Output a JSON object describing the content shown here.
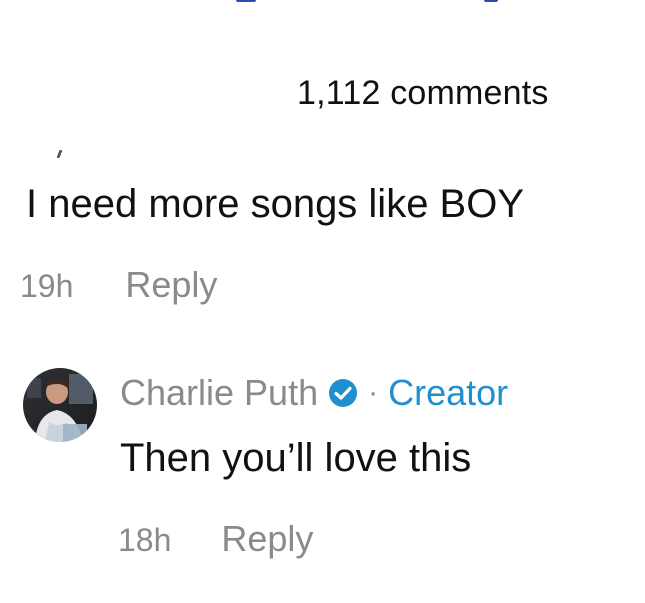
{
  "header": {
    "comment_count": "1,112 comments"
  },
  "comment": {
    "text": "I need more songs like BOY",
    "time": "19h",
    "reply_label": "Reply"
  },
  "reply": {
    "author": "Charlie Puth",
    "separator": "·",
    "badge": "Creator",
    "text": "Then you’ll love this",
    "time": "18h",
    "reply_label": "Reply"
  },
  "colors": {
    "creator_badge": "#1f8fcf",
    "verified_icon": "#1f8fcf",
    "muted_text": "#8a8a8a",
    "primary_text": "#111111"
  },
  "icons": {
    "verified": "verified-check-icon"
  }
}
